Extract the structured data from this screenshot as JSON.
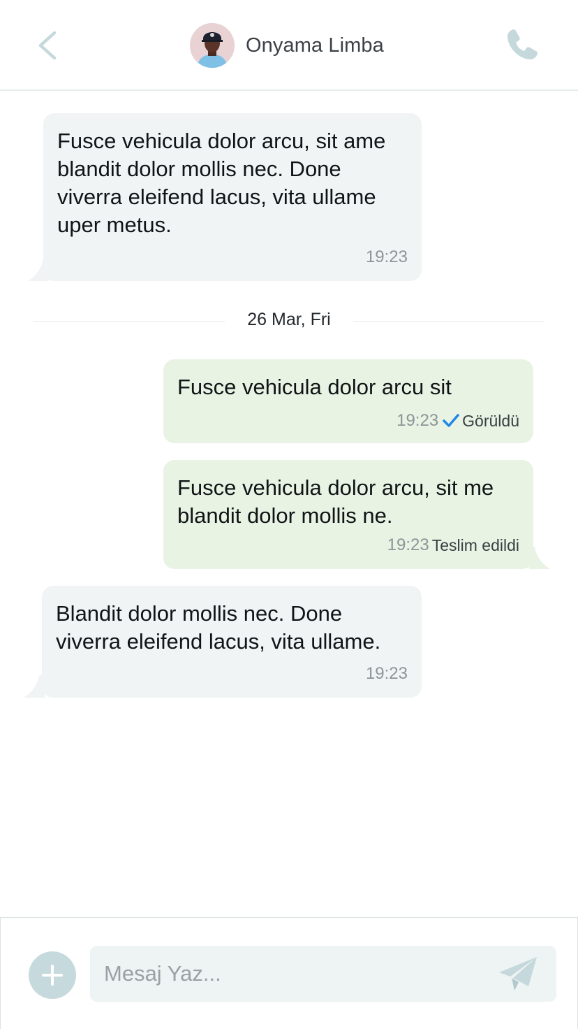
{
  "header": {
    "contact_name": "Onyama Limba",
    "back_icon": "chevron-left-icon",
    "call_icon": "phone-icon",
    "accent_color": "#c5d8dc"
  },
  "messages": [
    {
      "direction": "incoming",
      "text": "Fusce vehicula dolor arcu, sit ame blandit dolor mollis nec. Done viverra eleifend lacus, vita ullame uper metus.",
      "time": "19:23"
    },
    {
      "direction": "outgoing",
      "text": "Fusce vehicula dolor arcu sit",
      "time": "19:23",
      "status": "Görüldü",
      "status_icon": "check-icon"
    },
    {
      "direction": "outgoing",
      "text": "Fusce vehicula dolor arcu, sit me blandit dolor mollis ne.",
      "time": "19:23",
      "status": "Teslim edildi"
    },
    {
      "direction": "incoming",
      "text": "Blandit dolor mollis nec. Done viverra eleifend lacus, vita ullame.",
      "time": "19:23"
    }
  ],
  "date_separator": "26 Mar, Fri",
  "composer": {
    "placeholder": "Mesaj Yaz...",
    "add_icon": "plus-icon",
    "send_icon": "send-icon"
  },
  "colors": {
    "incoming_bubble": "#f0f4f4",
    "outgoing_bubble": "#e8f3e3",
    "check_blue": "#1f87e8"
  }
}
